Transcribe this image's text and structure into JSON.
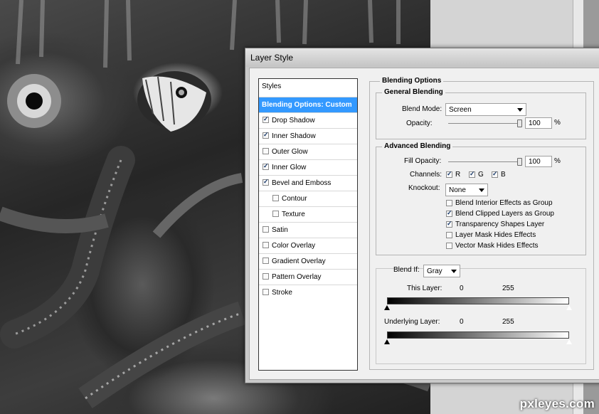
{
  "dialog": {
    "title": "Layer Style"
  },
  "styles_list": {
    "header": "Styles",
    "selected": "Blending Options: Custom",
    "items": [
      {
        "label": "Drop Shadow",
        "checked": true,
        "indent": false
      },
      {
        "label": "Inner Shadow",
        "checked": true,
        "indent": false
      },
      {
        "label": "Outer Glow",
        "checked": false,
        "indent": false
      },
      {
        "label": "Inner Glow",
        "checked": true,
        "indent": false
      },
      {
        "label": "Bevel and Emboss",
        "checked": true,
        "indent": false
      },
      {
        "label": "Contour",
        "checked": false,
        "indent": true
      },
      {
        "label": "Texture",
        "checked": false,
        "indent": true
      },
      {
        "label": "Satin",
        "checked": false,
        "indent": false
      },
      {
        "label": "Color Overlay",
        "checked": false,
        "indent": false
      },
      {
        "label": "Gradient Overlay",
        "checked": false,
        "indent": false
      },
      {
        "label": "Pattern Overlay",
        "checked": false,
        "indent": false
      },
      {
        "label": "Stroke",
        "checked": false,
        "indent": false
      }
    ]
  },
  "blending_options": {
    "title": "Blending Options",
    "general": {
      "title": "General Blending",
      "blend_mode_label": "Blend Mode:",
      "blend_mode_value": "Screen",
      "opacity_label": "Opacity:",
      "opacity_value": "100",
      "opacity_percent": 100,
      "percent_sign": "%"
    },
    "advanced": {
      "title": "Advanced Blending",
      "fill_opacity_label": "Fill Opacity:",
      "fill_opacity_value": "100",
      "fill_opacity_percent": 100,
      "percent_sign": "%",
      "channels_label": "Channels:",
      "channels": [
        {
          "label": "R",
          "checked": true
        },
        {
          "label": "G",
          "checked": true
        },
        {
          "label": "B",
          "checked": true
        }
      ],
      "knockout_label": "Knockout:",
      "knockout_value": "None",
      "options": [
        {
          "label": "Blend Interior Effects as Group",
          "checked": false
        },
        {
          "label": "Blend Clipped Layers as Group",
          "checked": true
        },
        {
          "label": "Transparency Shapes Layer",
          "checked": true
        },
        {
          "label": "Layer Mask Hides Effects",
          "checked": false
        },
        {
          "label": "Vector Mask Hides Effects",
          "checked": false
        }
      ]
    },
    "blend_if": {
      "label": "Blend If:",
      "value": "Gray",
      "this_layer_label": "This Layer:",
      "this_layer_min": "0",
      "this_layer_max": "255",
      "underlying_label": "Underlying Layer:",
      "underlying_min": "0",
      "underlying_max": "255"
    }
  },
  "watermark": "pxleyes.com"
}
